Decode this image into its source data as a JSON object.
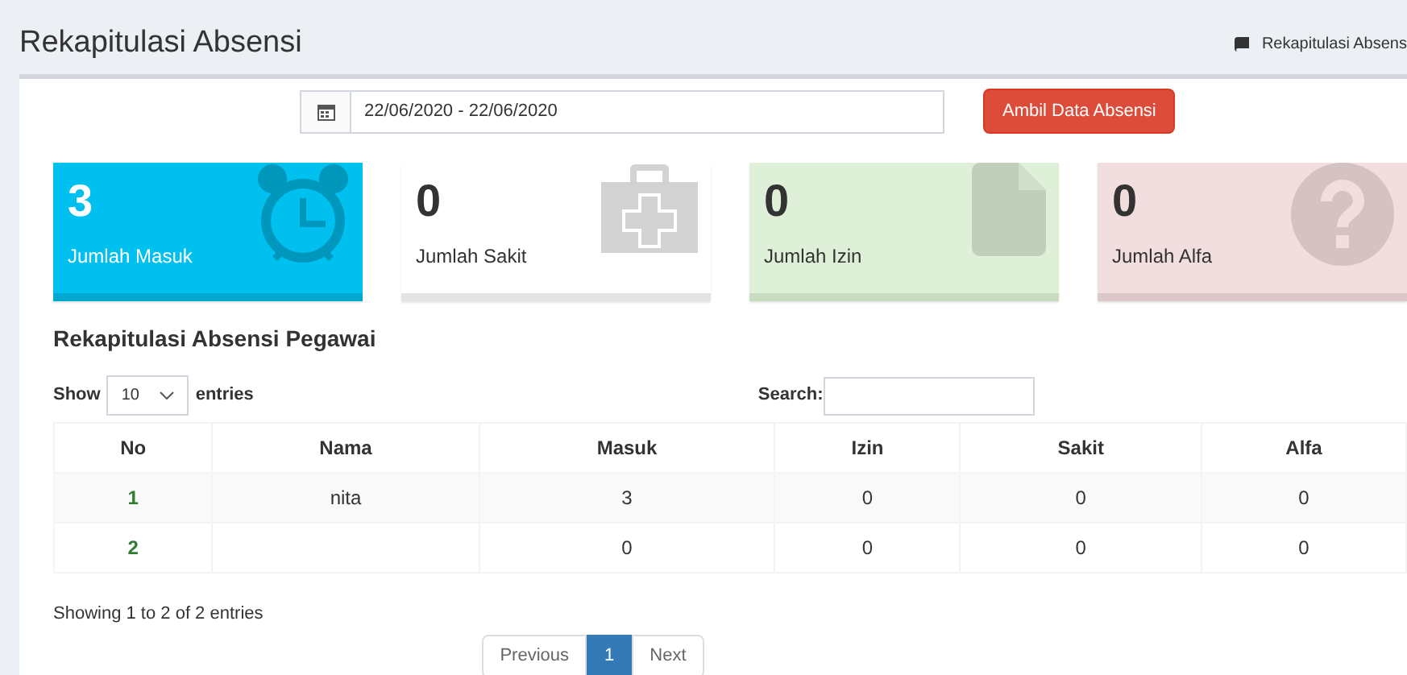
{
  "header": {
    "title": "Rekapitulasi Absensi",
    "breadcrumb": "Rekapitulasi Absens"
  },
  "filter": {
    "date_range": "22/06/2020 - 22/06/2020",
    "button": "Ambil Data Absensi"
  },
  "cards": [
    {
      "kind": "masuk",
      "value": "3",
      "label": "Jumlah Masuk"
    },
    {
      "kind": "sakit",
      "value": "0",
      "label": "Jumlah Sakit"
    },
    {
      "kind": "izin",
      "value": "0",
      "label": "Jumlah Izin"
    },
    {
      "kind": "alfa",
      "value": "0",
      "label": "Jumlah Alfa"
    }
  ],
  "table_section": {
    "title": "Rekapitulasi Absensi Pegawai",
    "show_label": "Show",
    "page_size": "10",
    "entries_label": "entries",
    "search_label": "Search:",
    "columns": [
      "No",
      "Nama",
      "Masuk",
      "Izin",
      "Sakit",
      "Alfa"
    ],
    "rows": [
      [
        "1",
        "nita",
        "3",
        "0",
        "0",
        "0"
      ],
      [
        "2",
        "",
        "0",
        "0",
        "0",
        "0"
      ]
    ],
    "info": "Showing 1 to 2 of 2 entries",
    "pagination": [
      {
        "label": "Previous",
        "selected": false
      },
      {
        "label": "1",
        "selected": true
      },
      {
        "label": "Next",
        "selected": false
      }
    ]
  }
}
